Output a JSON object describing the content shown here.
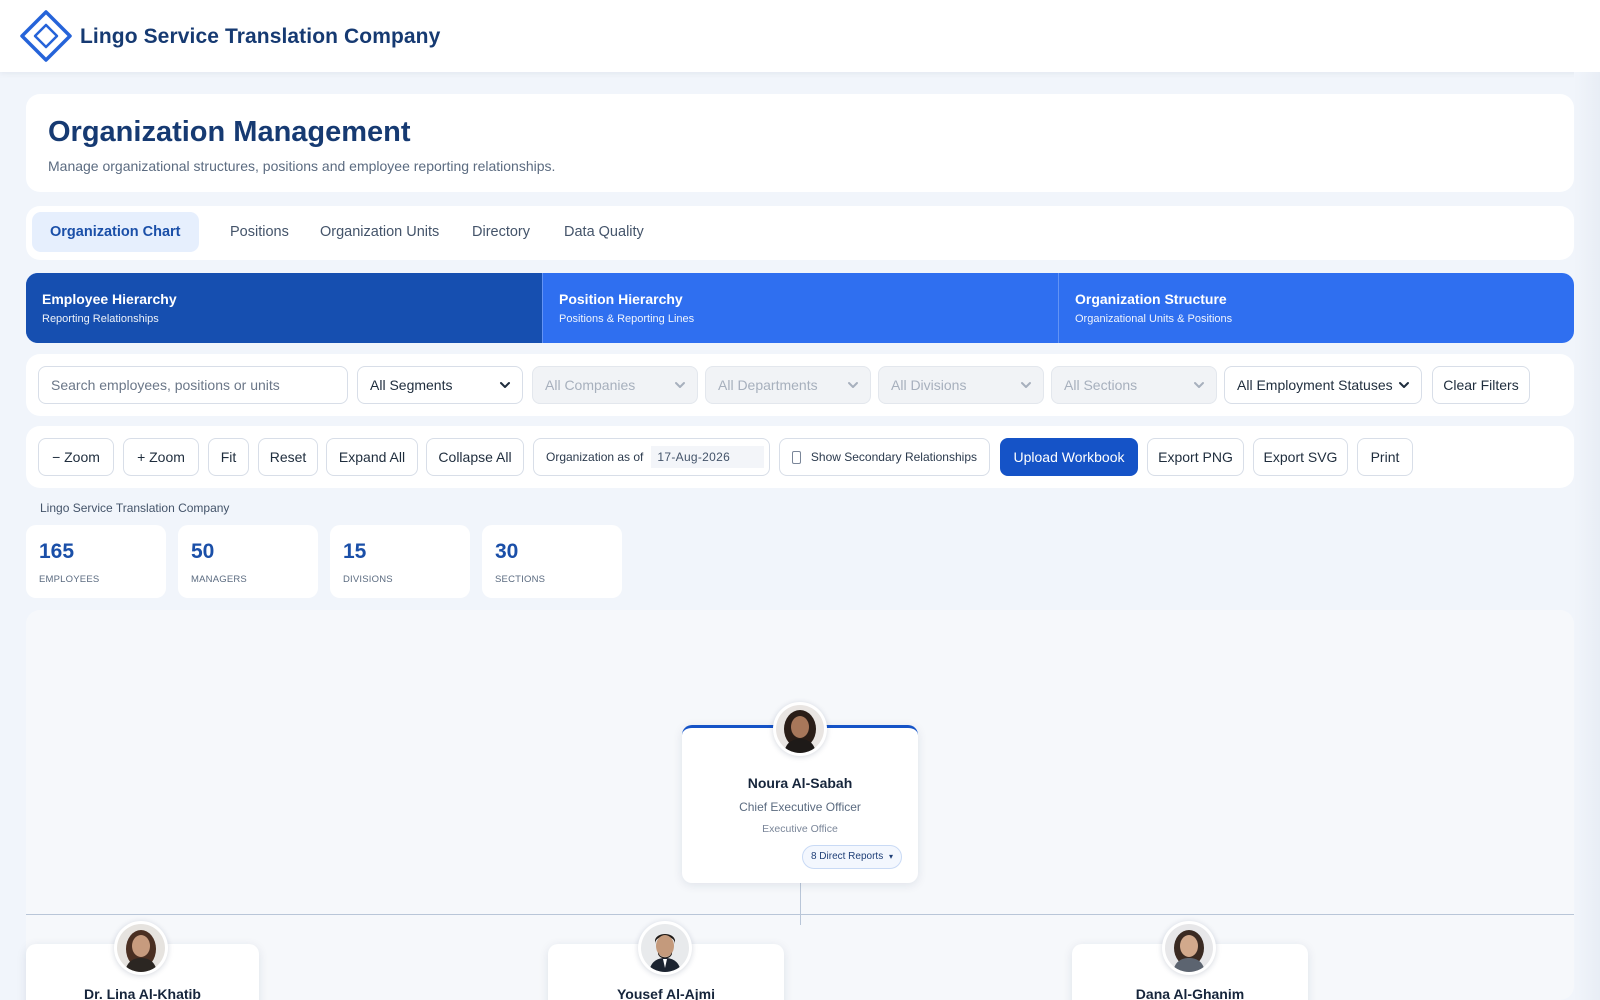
{
  "header": {
    "company_name": "Lingo Service Translation Company"
  },
  "page": {
    "title": "Organization Management",
    "subtitle": "Manage organizational structures, positions and employee reporting relationships."
  },
  "tabs": [
    {
      "label": "Organization Chart",
      "active": true
    },
    {
      "label": "Positions"
    },
    {
      "label": "Organization Units"
    },
    {
      "label": "Directory"
    },
    {
      "label": "Data Quality"
    }
  ],
  "hierarchy_modes": [
    {
      "title": "Employee Hierarchy",
      "subtitle": "Reporting Relationships",
      "active": true
    },
    {
      "title": "Position Hierarchy",
      "subtitle": "Positions & Reporting Lines"
    },
    {
      "title": "Organization Structure",
      "subtitle": "Organizational Units & Positions"
    }
  ],
  "filters": {
    "search_placeholder": "Search employees, positions or units",
    "segments": "All Segments",
    "companies": "All Companies",
    "departments": "All Departments",
    "divisions": "All Divisions",
    "sections": "All Sections",
    "employment_statuses": "All Employment Statuses",
    "clear_label": "Clear Filters"
  },
  "toolbar": {
    "zoom_out": "− Zoom",
    "zoom_in": "+ Zoom",
    "fit": "Fit",
    "reset": "Reset",
    "expand_all": "Expand All",
    "collapse_all": "Collapse All",
    "as_of_label": "Organization as of",
    "as_of_date": "17-Aug-2026",
    "secondary_label": "Show Secondary Relationships",
    "secondary_checked": false,
    "upload": "Upload Workbook",
    "export_png": "Export PNG",
    "export_svg": "Export SVG",
    "print": "Print"
  },
  "org_caption": "Lingo Service Translation Company",
  "stats": [
    {
      "value": "165",
      "label": "Employees"
    },
    {
      "value": "50",
      "label": "Managers"
    },
    {
      "value": "15",
      "label": "Divisions"
    },
    {
      "value": "30",
      "label": "Sections"
    }
  ],
  "org_chart": {
    "root": {
      "name": "Noura Al-Sabah",
      "title": "Chief Executive Officer",
      "unit": "Executive Office",
      "direct_reports": "8 Direct Reports"
    },
    "children": [
      {
        "name": "Dr. Lina Al-Khatib"
      },
      {
        "name": "Yousef Al-Ajmi"
      },
      {
        "name": "Dana Al-Ghanim"
      }
    ]
  },
  "colors": {
    "brand": "#163a72",
    "primary": "#1553c7",
    "hierarchy_active": "#164fb0",
    "hierarchy_bar": "#2f6ff0",
    "stat_value": "#1a4fa8"
  }
}
